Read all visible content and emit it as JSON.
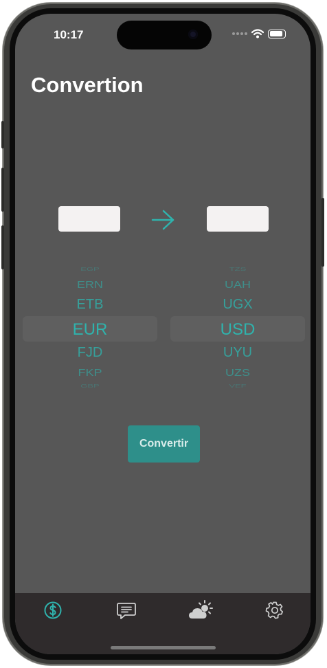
{
  "status": {
    "time": "10:17"
  },
  "page": {
    "title": "Convertion"
  },
  "converter": {
    "from_amount": "",
    "to_amount": "",
    "from_picker": {
      "items": [
        "EGP",
        "ERN",
        "ETB",
        "EUR",
        "FJD",
        "FKP",
        "GBP"
      ],
      "selected": "EUR"
    },
    "to_picker": {
      "items": [
        "TZS",
        "UAH",
        "UGX",
        "USD",
        "UYU",
        "UZS",
        "VEF"
      ],
      "selected": "USD"
    },
    "convert_label": "Convertir"
  },
  "tabbar": {
    "tabs": [
      {
        "icon": "dollar-circle-icon",
        "active": true
      },
      {
        "icon": "message-icon",
        "active": false
      },
      {
        "icon": "weather-icon",
        "active": false
      },
      {
        "icon": "gear-icon",
        "active": false
      }
    ]
  },
  "colors": {
    "accent": "#2fb3ad",
    "background": "#575757",
    "tabbar": "#2f2b2c",
    "inactive_icon": "#cfcfcf"
  }
}
